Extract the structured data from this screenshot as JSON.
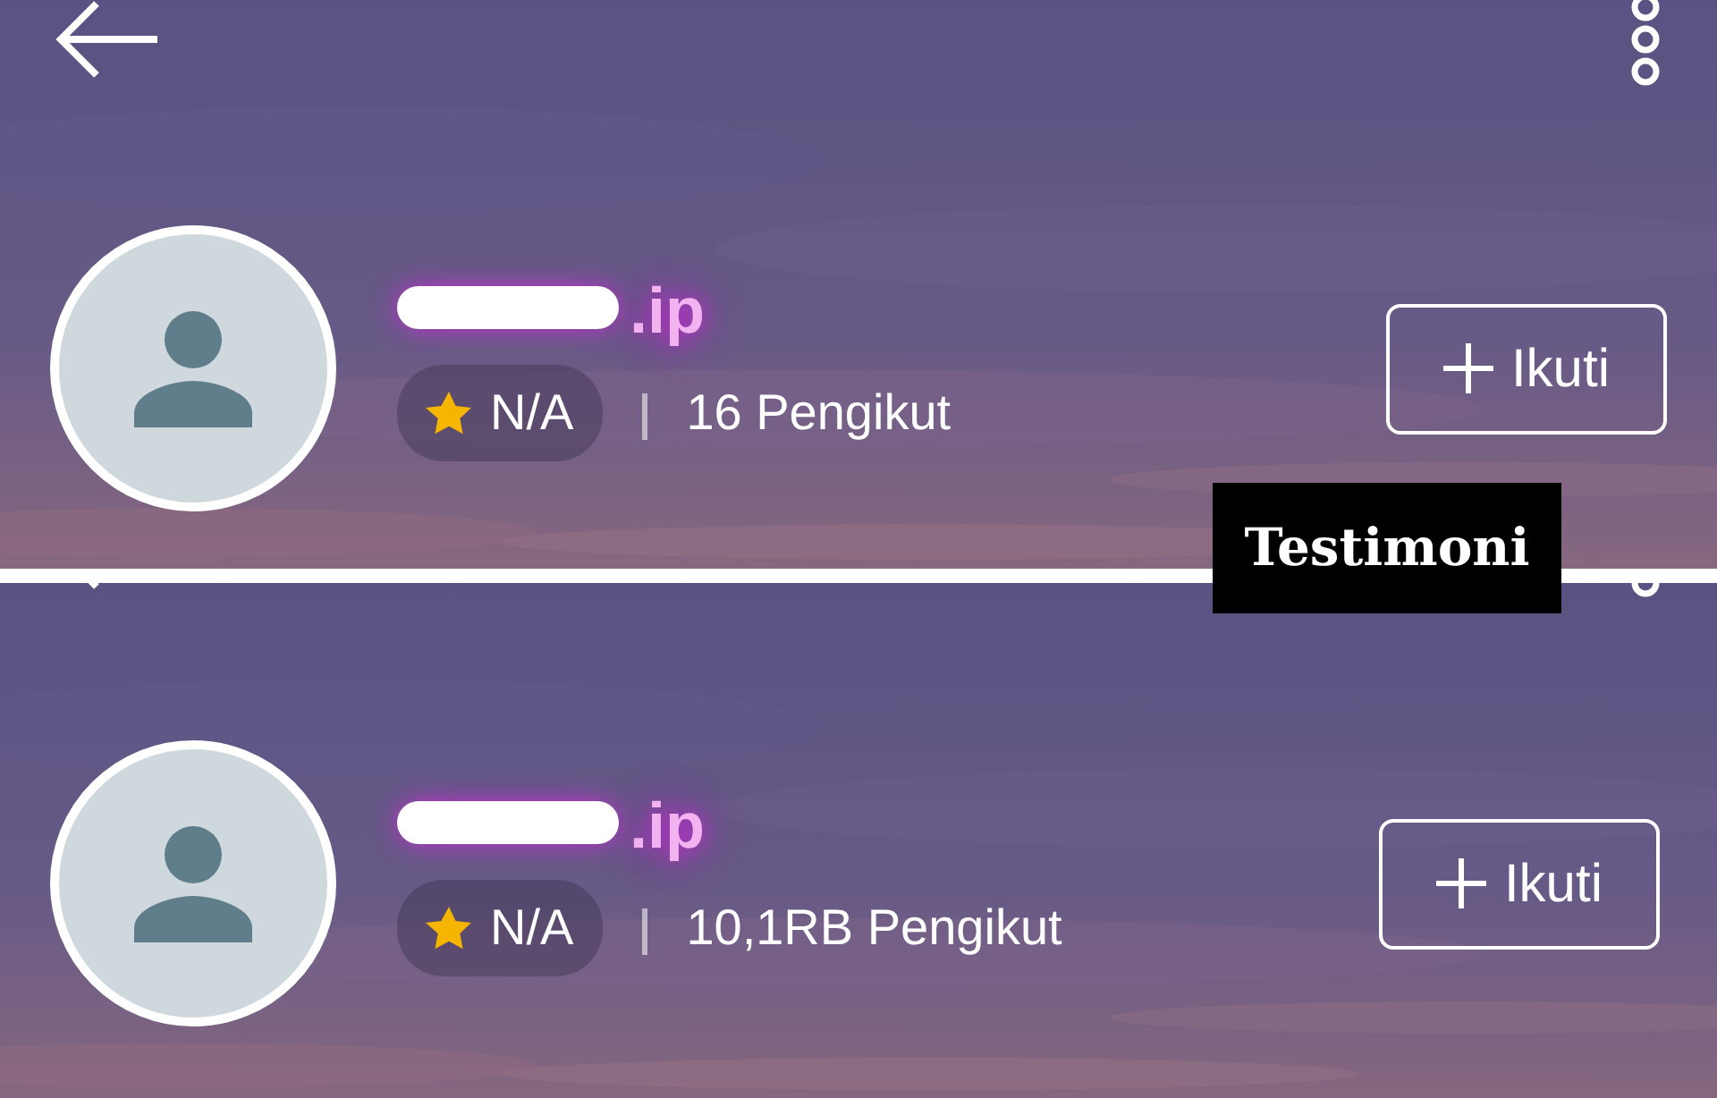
{
  "profiles": [
    {
      "name_visible": ".ip",
      "rating": "N/A",
      "followers": "16 Pengikut",
      "follow_button": "Ikuti",
      "header_cut": false
    },
    {
      "name_visible": ".ip",
      "rating": "N/A",
      "followers": "10,1RB Pengikut",
      "follow_button": "Ikuti",
      "header_cut": true
    }
  ],
  "overlay_label": "Testimoni"
}
